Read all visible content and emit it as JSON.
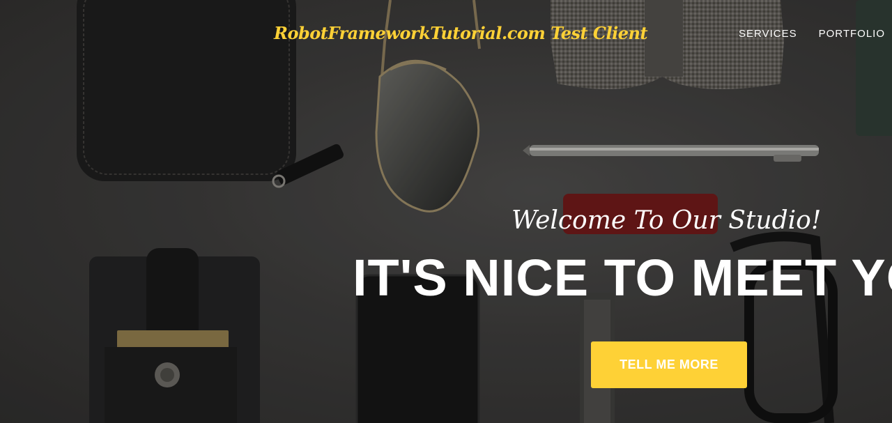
{
  "navbar": {
    "brand": "RobotFrameworkTutorial.com Test Client",
    "links": [
      {
        "label": "SERVICES"
      },
      {
        "label": "PORTFOLIO"
      }
    ]
  },
  "hero": {
    "lead": "Welcome To Our Studio!",
    "heading": "IT'S NICE TO MEET YOU",
    "button_label": "TELL ME MORE"
  },
  "colors": {
    "accent": "#fed136",
    "text": "#ffffff",
    "background": "#3a3938"
  }
}
